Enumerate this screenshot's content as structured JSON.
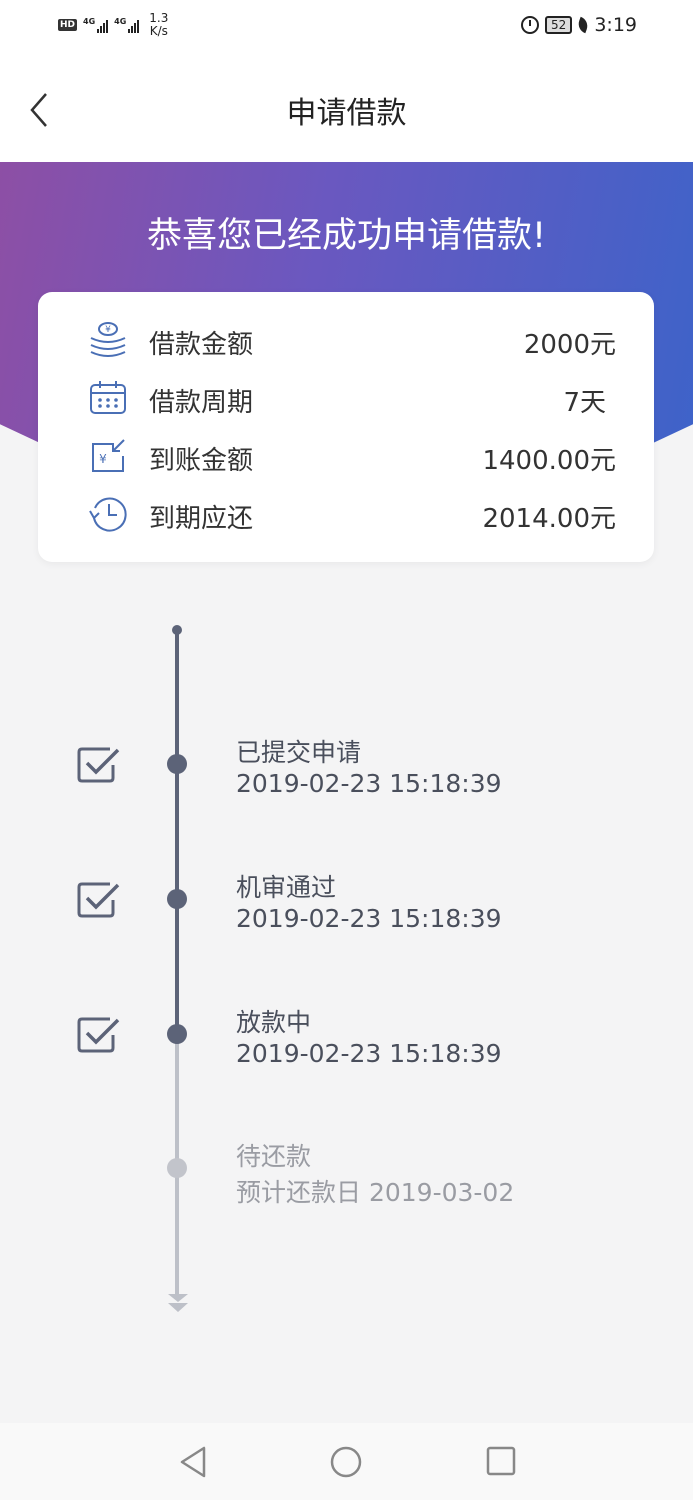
{
  "status_bar": {
    "network_speed": "1.3\nK/s",
    "speed_value": "1.3",
    "speed_unit": "K/s",
    "hd": "HD",
    "signal1": "4G",
    "signal2": "4G",
    "battery": "52",
    "time": "3:19"
  },
  "nav": {
    "title": "申请借款"
  },
  "hero": {
    "title": "恭喜您已经成功申请借款!"
  },
  "summary": {
    "items": [
      {
        "label": "借款金额",
        "value": "2000元",
        "icon": "coins-yen-icon"
      },
      {
        "label": "借款周期",
        "value": "7天",
        "icon": "calendar-icon"
      },
      {
        "label": "到账金额",
        "value": "1400.00元",
        "icon": "incoming-money-icon"
      },
      {
        "label": "到期应还",
        "value": "2014.00元",
        "icon": "history-clock-icon"
      }
    ]
  },
  "timeline": {
    "steps": [
      {
        "title": "已提交申请",
        "subtitle": "2019-02-23 15:18:39",
        "status": "done"
      },
      {
        "title": "机审通过",
        "subtitle": "2019-02-23 15:18:39",
        "status": "done"
      },
      {
        "title": "放款中",
        "subtitle": "2019-02-23 15:18:39",
        "status": "done"
      },
      {
        "title": "待还款",
        "subtitle": "预计还款日 2019-03-02",
        "status": "pending"
      }
    ]
  },
  "colors": {
    "gradient_start": "#8d4fa5",
    "gradient_end": "#3e63c9",
    "timeline_active": "#5c6378",
    "timeline_pending": "#c2c4cb",
    "icon_blue": "#4a6fb5"
  }
}
